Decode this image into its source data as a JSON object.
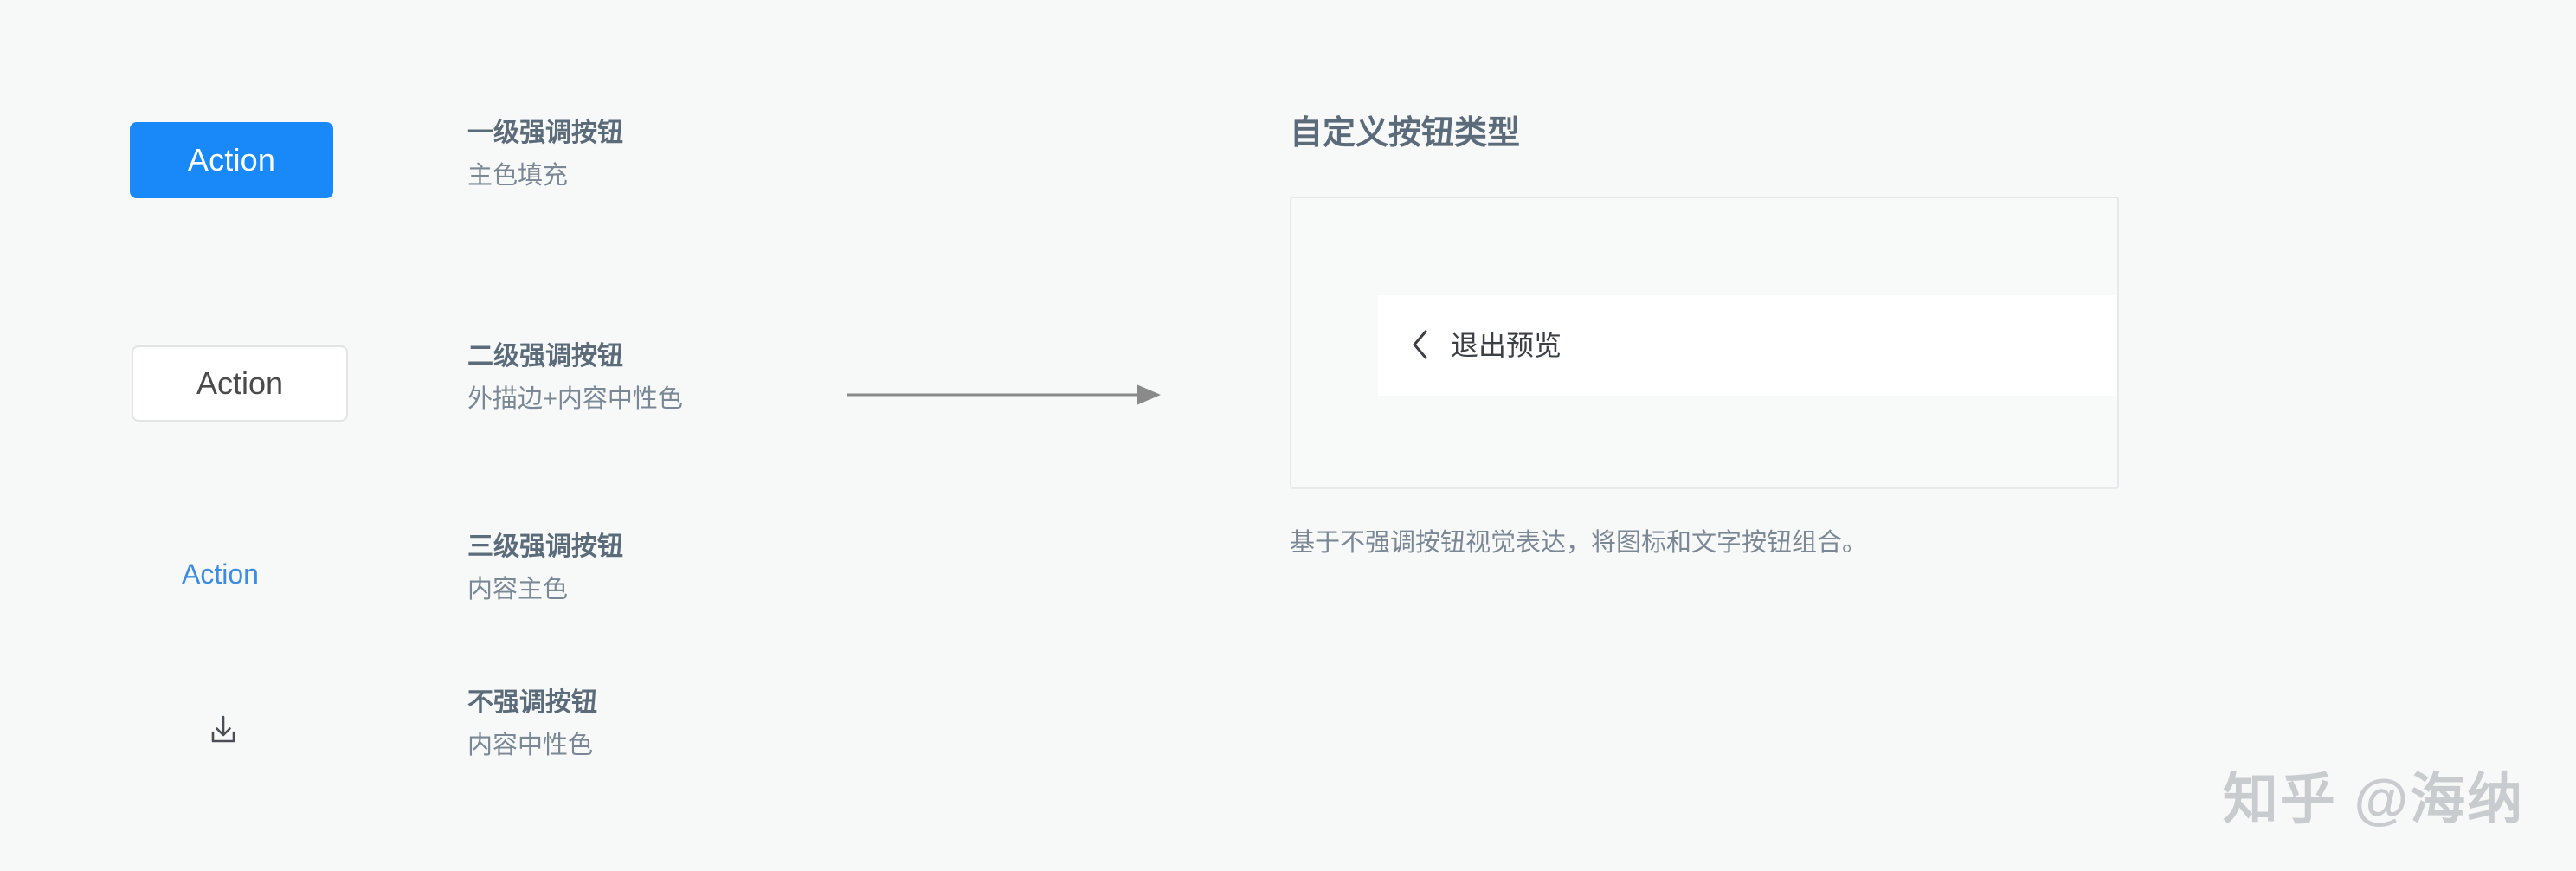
{
  "page": {
    "background_color": "#f7f8f8"
  },
  "colors": {
    "primary_blue": "#1989fa",
    "tertiary_blue": "#3d8ce0",
    "title_text": "#5b6b7a",
    "sub_text": "#7b8794",
    "border": "#e2e4e6",
    "arrow": "#8a8a8a",
    "watermark": "#c9cccf"
  },
  "spec_rows": [
    {
      "demo_label": "Action",
      "title": "一级强调按钮",
      "subtitle": "主色填充",
      "style": "primary"
    },
    {
      "demo_label": "Action",
      "title": "二级强调按钮",
      "subtitle": "外描边+内容中性色",
      "style": "secondary"
    },
    {
      "demo_label": "Action",
      "title": "三级强调按钮",
      "subtitle": "内容主色",
      "style": "tertiary"
    },
    {
      "demo_label": "",
      "icon": "download-icon",
      "title": "不强调按钮",
      "subtitle": "内容中性色",
      "style": "quiet"
    }
  ],
  "connector": {
    "icon": "arrow-right-icon"
  },
  "right_panel": {
    "title": "自定义按钮类型",
    "preview": {
      "back_button_label": "退出预览",
      "back_button_icon": "chevron-left-icon"
    },
    "caption": "基于不强调按钮视觉表达，将图标和文字按钮组合。"
  },
  "watermark": {
    "text": "知乎 @海纳"
  }
}
